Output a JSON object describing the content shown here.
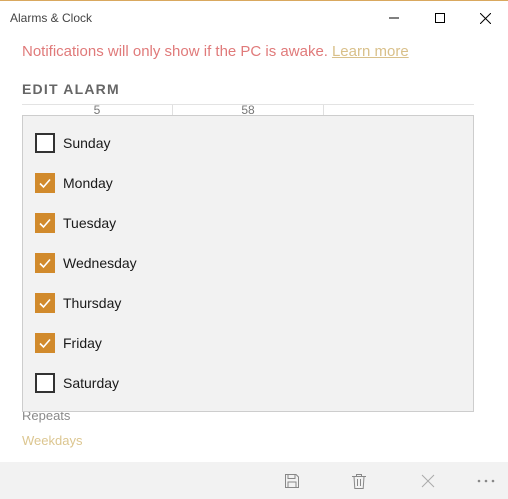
{
  "window": {
    "title": "Alarms & Clock",
    "accent_color": "#d18a2c",
    "controls": [
      "minimize-icon",
      "maximize-icon",
      "close-icon"
    ]
  },
  "notice": {
    "text": "Notifications will only show if the PC is awake.",
    "link_text": "Learn more"
  },
  "heading": "EDIT ALARM",
  "time": {
    "hour": "5",
    "minute": "58"
  },
  "days": [
    {
      "label": "Sunday",
      "checked": false
    },
    {
      "label": "Monday",
      "checked": true
    },
    {
      "label": "Tuesday",
      "checked": true
    },
    {
      "label": "Wednesday",
      "checked": true
    },
    {
      "label": "Thursday",
      "checked": true
    },
    {
      "label": "Friday",
      "checked": true
    },
    {
      "label": "Saturday",
      "checked": false
    }
  ],
  "repeats": {
    "label": "Repeats",
    "value": "Weekdays"
  },
  "toolbar": {
    "icons": [
      "save-icon",
      "delete-icon",
      "cancel-icon",
      "more-icon"
    ]
  }
}
